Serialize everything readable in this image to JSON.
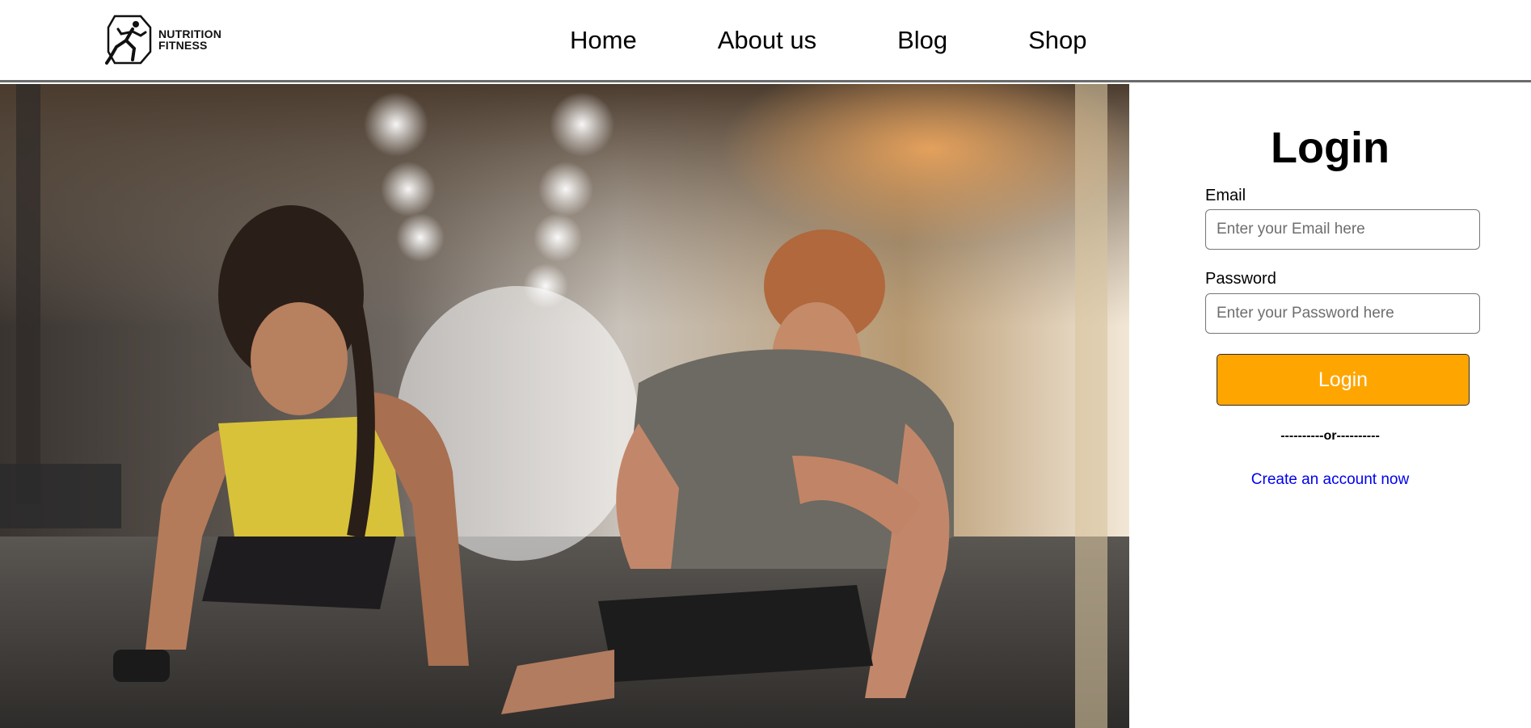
{
  "brand": {
    "line1": "NUTRITION",
    "line2": "FITNESS"
  },
  "nav": {
    "items": [
      {
        "label": "Home"
      },
      {
        "label": "About us"
      },
      {
        "label": "Blog"
      },
      {
        "label": "Shop"
      }
    ]
  },
  "hero": {
    "image": "gym-couple-pushups-photo"
  },
  "login": {
    "title": "Login",
    "email_label": "Email",
    "email_placeholder": "Enter your Email here",
    "password_label": "Password",
    "password_placeholder": "Enter your Password here",
    "button_label": "Login",
    "divider": "----------or----------",
    "create_account": "Create an account now"
  },
  "colors": {
    "accent": "#ffa500",
    "link": "#0000ee",
    "header_border": "#6b6b6b"
  }
}
